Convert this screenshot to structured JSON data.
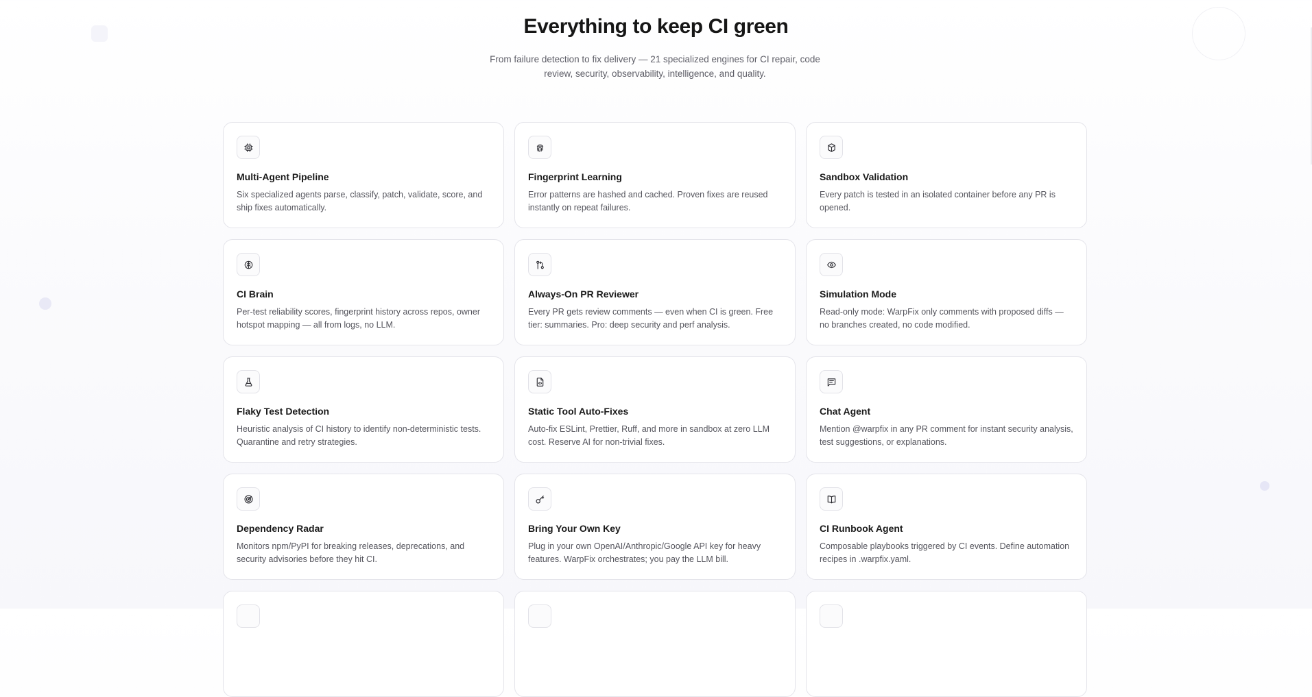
{
  "header": {
    "title": "Everything to keep CI green",
    "subtitle": "From failure detection to fix delivery — 21 specialized engines for CI repair, code review, security, observability, intelligence, and quality."
  },
  "features": [
    {
      "icon": "cpu-icon",
      "title": "Multi-Agent Pipeline",
      "description": "Six specialized agents parse, classify, patch, validate, score, and ship fixes automatically."
    },
    {
      "icon": "fingerprint-icon",
      "title": "Fingerprint Learning",
      "description": "Error patterns are hashed and cached. Proven fixes are reused instantly on repeat failures."
    },
    {
      "icon": "box-icon",
      "title": "Sandbox Validation",
      "description": "Every patch is tested in an isolated container before any PR is opened."
    },
    {
      "icon": "brain-icon",
      "title": "CI Brain",
      "description": "Per-test reliability scores, fingerprint history across repos, owner hotspot mapping — all from logs, no LLM."
    },
    {
      "icon": "git-pull-request-icon",
      "title": "Always-On PR Reviewer",
      "description": "Every PR gets review comments — even when CI is green. Free tier: summaries. Pro: deep security and perf analysis."
    },
    {
      "icon": "eye-icon",
      "title": "Simulation Mode",
      "description": "Read-only mode: WarpFix only comments with proposed diffs — no branches created, no code modified."
    },
    {
      "icon": "flask-icon",
      "title": "Flaky Test Detection",
      "description": "Heuristic analysis of CI history to identify non-deterministic tests. Quarantine and retry strategies."
    },
    {
      "icon": "file-code-icon",
      "title": "Static Tool Auto-Fixes",
      "description": "Auto-fix ESLint, Prettier, Ruff, and more in sandbox at zero LLM cost. Reserve AI for non-trivial fixes."
    },
    {
      "icon": "message-icon",
      "title": "Chat Agent",
      "description": "Mention @warpfix in any PR comment for instant security analysis, test suggestions, or explanations."
    },
    {
      "icon": "radar-icon",
      "title": "Dependency Radar",
      "description": "Monitors npm/PyPI for breaking releases, deprecations, and security advisories before they hit CI."
    },
    {
      "icon": "key-icon",
      "title": "Bring Your Own Key",
      "description": "Plug in your own OpenAI/Anthropic/Google API key for heavy features. WarpFix orchestrates; you pay the LLM bill."
    },
    {
      "icon": "book-icon",
      "title": "CI Runbook Agent",
      "description": "Composable playbooks triggered by CI events. Define automation recipes in .warpfix.yaml."
    },
    {
      "icon": "",
      "title": "",
      "description": ""
    },
    {
      "icon": "",
      "title": "",
      "description": ""
    },
    {
      "icon": "",
      "title": "",
      "description": ""
    }
  ]
}
